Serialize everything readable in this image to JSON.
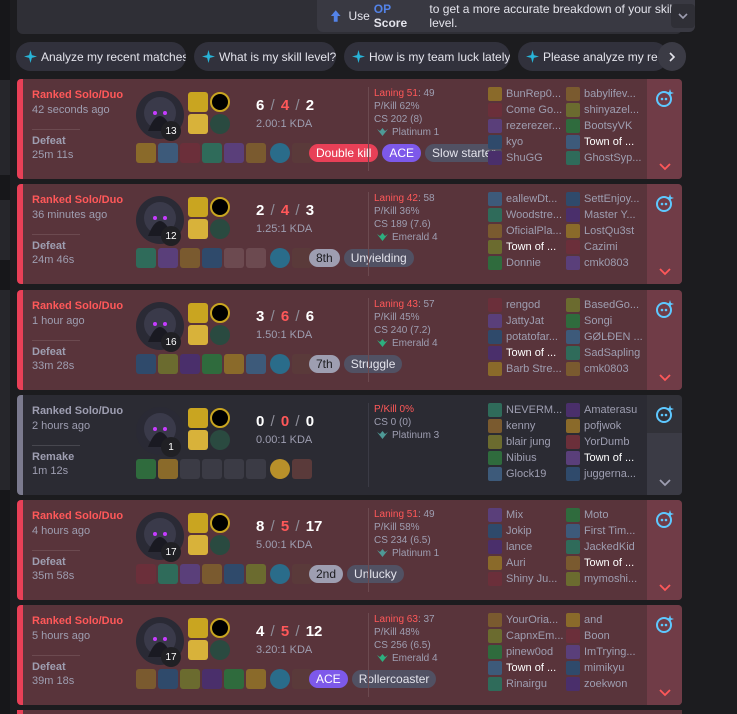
{
  "hint": {
    "pre": "Use",
    "op": "OP",
    "score": "Score",
    "post": "to get a more accurate breakdown of your skill level."
  },
  "chips": [
    "Analyze my recent matches.",
    "What is my skill level?",
    "How is my team luck lately?",
    "Please analyze my recent"
  ],
  "colors": {
    "defeat_accent": "#e84057",
    "defeat_bg": "#59343b",
    "remake_bg": "#2b2b33",
    "op_blue": "#5383e8",
    "ace_purple": "#7d59ea"
  },
  "matches": [
    {
      "queue": "Ranked Solo/Duo",
      "ago": "42 seconds ago",
      "result": "Defeat",
      "duration": "25m 11s",
      "level": "13",
      "k": "6",
      "d": "4",
      "a": "2",
      "kda": "2.00:1 KDA",
      "laning_label": "Laning 51",
      "laning_rest": ": 49",
      "pkill": "P/Kill 62%",
      "cs": "CS 202 (8)",
      "tier": "Platinum 1",
      "badges": [
        "Double kill",
        "ACE",
        "Slow starter"
      ],
      "team1": [
        "BunRep0...",
        "Come Go...",
        "rezerezer...",
        "kyo",
        "ShuGG"
      ],
      "team2": [
        "babylifev...",
        "shinyazel...",
        "BootsyVK",
        "Town of ...",
        "GhostSyp..."
      ],
      "me": "t2-3"
    },
    {
      "queue": "Ranked Solo/Duo",
      "ago": "36 minutes ago",
      "result": "Defeat",
      "duration": "24m 46s",
      "level": "12",
      "k": "2",
      "d": "4",
      "a": "3",
      "kda": "1.25:1 KDA",
      "laning_label": "Laning 42",
      "laning_rest": ": 58",
      "pkill": "P/Kill 36%",
      "cs": "CS 189 (7.6)",
      "tier": "Emerald 4",
      "badges": [
        "8th",
        "Unyielding"
      ],
      "team1": [
        "eallewDt...",
        "Woodstre...",
        "OficialPla...",
        "Town of ...",
        "Donnie"
      ],
      "team2": [
        "SettEnjoy...",
        "Master Y...",
        "LostQu3st",
        "Cazimi",
        "cmk0803"
      ],
      "me": "t1-3"
    },
    {
      "queue": "Ranked Solo/Duo",
      "ago": "1 hour ago",
      "result": "Defeat",
      "duration": "33m 28s",
      "level": "16",
      "k": "3",
      "d": "6",
      "a": "6",
      "kda": "1.50:1 KDA",
      "laning_label": "Laning 43",
      "laning_rest": ": 57",
      "pkill": "P/Kill 45%",
      "cs": "CS 240 (7.2)",
      "tier": "Emerald 4",
      "badges": [
        "7th",
        "Struggle"
      ],
      "team1": [
        "rengod",
        "JattyJat",
        "potatofar...",
        "Town of ...",
        "Barb Stre..."
      ],
      "team2": [
        "BasedGo...",
        "Songi",
        "GØLÐEN ...",
        "SadSapling",
        "cmk0803"
      ],
      "me": "t1-3"
    },
    {
      "queue": "Ranked Solo/Duo",
      "ago": "2 hours ago",
      "result": "Remake",
      "duration": "1m 12s",
      "level": "1",
      "k": "0",
      "d": "0",
      "a": "0",
      "kda": "0.00:1 KDA",
      "laning_label": "",
      "laning_rest": "",
      "pkill": "P/Kill 0%",
      "cs": "CS 0 (0)",
      "tier": "Platinum 3",
      "badges": [],
      "team1": [
        "NEVERM...",
        "kenny",
        "blair jung",
        "Nibius",
        "Glock19"
      ],
      "team2": [
        "Amaterasu",
        "pofjwok",
        "YorDumb",
        "Town of ...",
        "juggerna..."
      ],
      "me": "t2-3"
    },
    {
      "queue": "Ranked Solo/Duo",
      "ago": "4 hours ago",
      "result": "Defeat",
      "duration": "35m 58s",
      "level": "17",
      "k": "8",
      "d": "5",
      "a": "17",
      "kda": "5.00:1 KDA",
      "laning_label": "Laning 51",
      "laning_rest": ": 49",
      "pkill": "P/Kill 58%",
      "cs": "CS 234 (6.5)",
      "tier": "Platinum 1",
      "badges": [
        "2nd",
        "Unlucky"
      ],
      "team1": [
        "Mix",
        "Jokip",
        "lance",
        "Auri",
        "Shiny Ju..."
      ],
      "team2": [
        "Moto",
        "First Tim...",
        "JackedKid",
        "Town of ...",
        "mymoshi..."
      ],
      "me": "t2-3"
    },
    {
      "queue": "Ranked Solo/Duo",
      "ago": "5 hours ago",
      "result": "Defeat",
      "duration": "39m 18s",
      "level": "17",
      "k": "4",
      "d": "5",
      "a": "12",
      "kda": "3.20:1 KDA",
      "laning_label": "Laning 63",
      "laning_rest": ": 37",
      "pkill": "P/Kill 48%",
      "cs": "CS 256 (6.5)",
      "tier": "Emerald 4",
      "badges": [
        "ACE",
        "Rollercoaster"
      ],
      "team1": [
        "YourOria...",
        "CapnxEm...",
        "pinew0od",
        "Town of ...",
        "Rinairgu"
      ],
      "team2": [
        "and",
        "Boon",
        "ImTrying...",
        "mimikyu",
        "zoekwon"
      ],
      "me": "t1-3"
    }
  ]
}
